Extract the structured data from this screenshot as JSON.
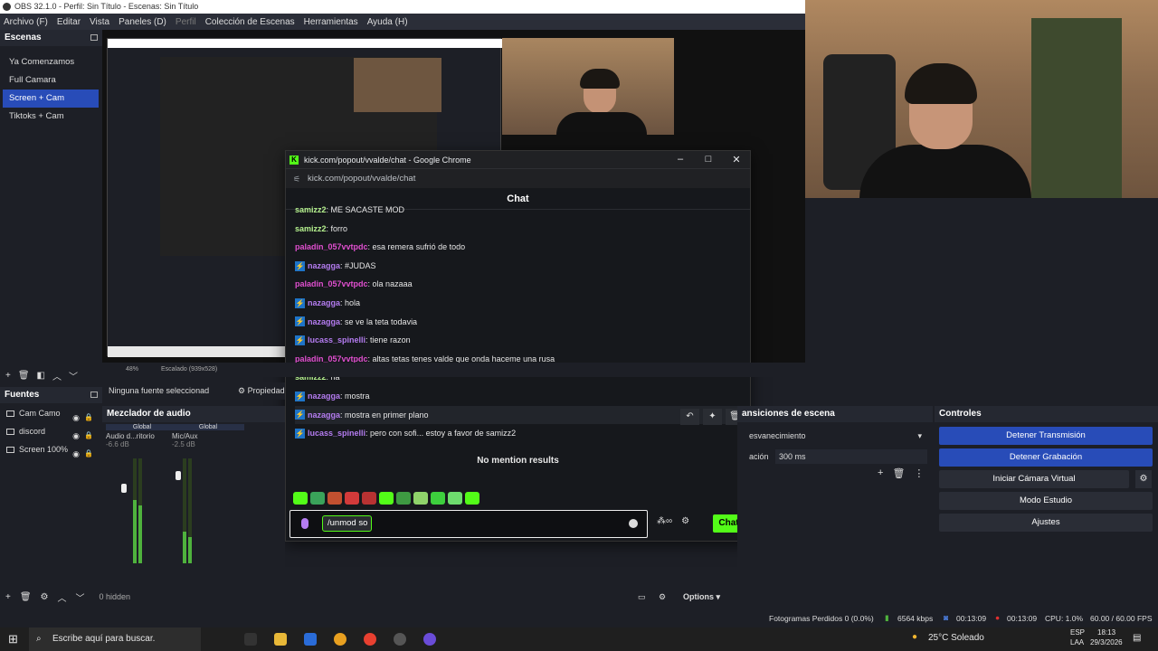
{
  "obs": {
    "title": "OBS 32.1.0 - Perfil: Sin Título - Escenas: Sin Título",
    "menu": [
      "Archivo (F)",
      "Editar",
      "Vista",
      "Paneles (D)",
      "Perfil",
      "Colección de Escenas",
      "Herramientas",
      "Ayuda (H)"
    ],
    "scenes_title": "Escenas",
    "scenes": [
      "Ya Comenzamos",
      "Full Camara",
      "Screen + Cam",
      "Tiktoks + Cam"
    ],
    "active_scene": "Screen + Cam",
    "no_source_selected": "Ninguna fuente seleccionad",
    "properties": "Propiedad",
    "sources_title": "Fuentes",
    "sources": [
      "Cam Camo",
      "discord",
      "Screen 100%"
    ],
    "mixer_title": "Mezclador de audio",
    "mixer": [
      {
        "scope": "Global",
        "name": "Audio d...ritorio",
        "db": "-6.6 dB"
      },
      {
        "scope": "Global",
        "name": "Mic/Aux",
        "db": "-2.5 dB"
      }
    ],
    "mixer_ticks": [
      "0",
      "-6",
      "-12",
      "-18",
      "-24",
      "-30",
      "-36",
      "-42",
      "-48",
      "-54",
      "-60"
    ],
    "hidden": "0 hidden",
    "transitions_title": "ansiciones de escena",
    "transition_value": "esvanecimiento",
    "duration_label": "ación",
    "duration_value": "300 ms",
    "controls_title": "Controles",
    "controls": [
      "Detener Transmisión",
      "Detener Grabación",
      "Iniciar Cámara Virtual",
      "Modo Estudio",
      "Ajustes"
    ],
    "options": "Options",
    "zoom": "48%",
    "scale": "Escalado (939x528)"
  },
  "chrome": {
    "title": "kick.com/popout/vvalde/chat - Google Chrome",
    "url": "kick.com/popout/vvalde/chat",
    "chat_header": "Chat",
    "messages": [
      {
        "user": "samizz2",
        "text": ": ME SACASTE MOD",
        "color": "green",
        "badge": false
      },
      {
        "user": "samizz2",
        "text": ": forro",
        "color": "green",
        "badge": false
      },
      {
        "user": "paladin_057vvtpdc",
        "text": ": esa remera sufrió de todo",
        "color": "pink",
        "badge": false
      },
      {
        "user": "nazagga",
        "text": ": #JUDAS",
        "color": "purple",
        "badge": true
      },
      {
        "user": "paladin_057vvtpdc",
        "text": ": ola nazaaa",
        "color": "pink",
        "badge": false
      },
      {
        "user": "nazagga",
        "text": ": hola",
        "color": "purple",
        "badge": true
      },
      {
        "user": "nazagga",
        "text": ": se ve la teta todavia",
        "color": "purple",
        "badge": true
      },
      {
        "user": "lucass_spinelli",
        "text": ": tiene razon",
        "color": "purple",
        "badge": true
      },
      {
        "user": "paladin_057vvtpdc",
        "text": ": altas tetas tenes valde que onda haceme una rusa",
        "color": "pink",
        "badge": false
      },
      {
        "user": "samizz2",
        "text": ": na",
        "color": "green",
        "badge": false
      },
      {
        "user": "nazagga",
        "text": ": mostra",
        "color": "purple",
        "badge": true
      },
      {
        "user": "nazagga",
        "text": ": mostra en primer plano",
        "color": "purple",
        "badge": true
      },
      {
        "user": "lucass_spinelli",
        "text": ": pero con sofi... estoy a favor de samizz2",
        "color": "purple",
        "badge": true
      }
    ],
    "no_mention": "No mention results",
    "input_value": "/unmod so",
    "send_label": "Chat"
  },
  "status": {
    "dropped": "Fotogramas Perdidos 0 (0.0%)",
    "bitrate": "6564 kbps",
    "stream_time": "00:13:09",
    "rec_time": "00:13:09",
    "cpu": "CPU: 1.0%",
    "fps": "60.00 / 60.00 FPS"
  },
  "taskbar": {
    "search_placeholder": "Escribe aquí para buscar.",
    "weather": "25°C  Soleado",
    "lang": "ESP",
    "lang2": "LAA",
    "time": "18:13",
    "date": "29/3/2026"
  },
  "colors": {
    "accent": "#284cb8",
    "kick_green": "#53fc18",
    "obs_bg": "#1d1f26"
  }
}
